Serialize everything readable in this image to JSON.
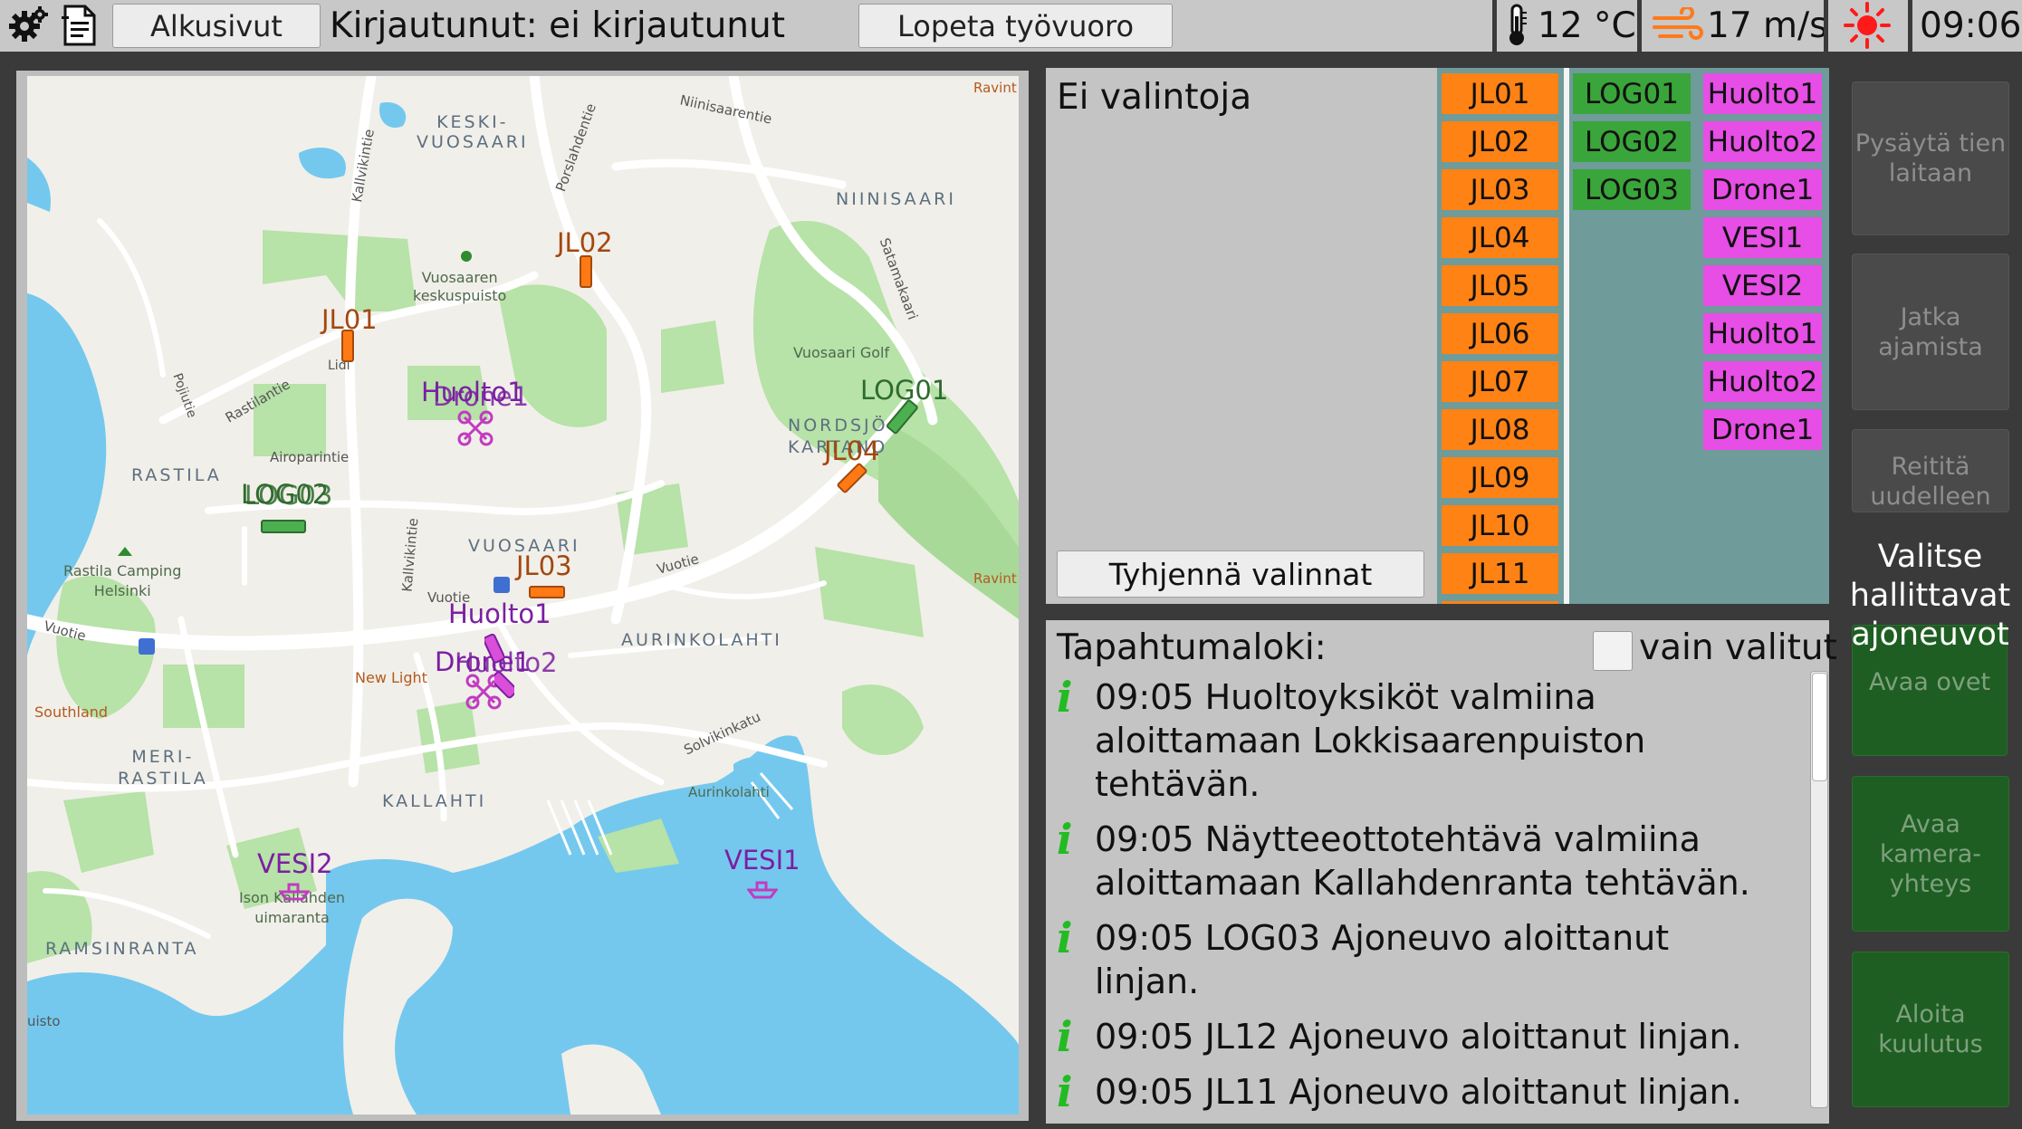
{
  "topbar": {
    "settings_icon": "gear-icon",
    "notes_icon": "document-icon",
    "home_button": "Alkusivut",
    "login_status": "Kirjautunut: ei kirjautunut",
    "end_shift_button": "Lopeta työvuoro",
    "temperature": "12 °C",
    "temperature_icon": "thermometer-icon",
    "wind": "17 m/s",
    "wind_icon": "wind-icon",
    "weather_icon": "sun-icon",
    "time": "09:06"
  },
  "map": {
    "place_labels": {
      "keskivuosaari_1": "KESKI-",
      "keskivuosaari_2": "VUOSAARI",
      "niinisaari": "NIINISAARI",
      "vuosaari_park_1": "Vuosaaren",
      "vuosaari_park_2": "keskuspuisto",
      "golf": "Vuosaari Golf",
      "nordsjo_1": "NORDSJÖ",
      "nordsjo_2": "KARTANO",
      "rastila": "RASTILA",
      "airoparintie": "Airoparintie",
      "camping_1": "Rastila Camping",
      "camping_2": "Helsinki",
      "vuosaari": "VUOSAARI",
      "aurinkolahti": "AURINKOLAHTI",
      "meri_1": "MERI-",
      "meri_2": "RASTILA",
      "kallahti": "KALLAHTI",
      "ramsinranta": "RAMSINRANTA",
      "southland": "Southland",
      "newlight": "New Light",
      "ison_1": "Ison Kallahden",
      "ison_2": "uimaranta",
      "aurinkolahti_beach": "Aurinkolahti",
      "ravint_top": "Ravint",
      "ravint_mid": "Ravint",
      "uisto": "uisto",
      "lidl": "Lidl"
    },
    "road_labels": {
      "kallvikintie_1": "Kallvikintie",
      "kallvikintie_2": "Kallvikintie",
      "porslahdentie": "Porslahdentie",
      "niinisaarentie": "Niinisaarentie",
      "satamakaari": "Satamakaari",
      "rastilantie": "Rastilantie",
      "pojiutie": "Pojiutie",
      "vuotie_1": "Vuotie",
      "vuotie_2": "Vuotie",
      "vuotie_3": "Vuotie",
      "solvikinkatu": "Solvikinkatu"
    },
    "vehicles": {
      "jl01": "JL01",
      "jl02": "JL02",
      "jl03": "JL03",
      "jl04": "JL04",
      "log01": "LOG01",
      "log02": "LOG02",
      "log03": "LOG03",
      "huolto1_a": "Huolto1",
      "drone1_a": "Drone1",
      "huolto1_b": "Huolto1",
      "huolto2_b": "Huolto2",
      "drone1_b": "Drone1",
      "vesi1": "VESI1",
      "vesi2": "VESI2"
    }
  },
  "selection": {
    "title": "Ei valintoja",
    "clear_button": "Tyhjennä valinnat",
    "jl_vehicles": [
      "JL01",
      "JL02",
      "JL03",
      "JL04",
      "JL05",
      "JL06",
      "JL07",
      "JL08",
      "JL09",
      "JL10",
      "JL11"
    ],
    "log_vehicles": [
      "LOG01",
      "LOG02",
      "LOG03"
    ],
    "service_vehicles": [
      "Huolto1",
      "Huolto2",
      "Drone1",
      "VESI1",
      "VESI2",
      "Huolto1",
      "Huolto2",
      "Drone1"
    ]
  },
  "event_log": {
    "title": "Tapahtumaloki:",
    "only_selected_label": "vain valitut",
    "info_icon": "info-icon",
    "entries": [
      "09:05 Huoltoyksiköt valmiina aloittamaan Lokkisaarenpuiston tehtävän.",
      "09:05 Näytteeottotehtävä valmiina aloittamaan Kallahdenranta tehtävän.",
      "09:05 LOG03 Ajoneuvo aloittanut linjan.",
      "09:05 JL12 Ajoneuvo aloittanut linjan.",
      "09:05 JL11 Ajoneuvo aloittanut linjan."
    ]
  },
  "actions": {
    "stop_roadside": "Pysäytä tien laitaan",
    "continue_driving": "Jatka ajamista",
    "reroute": "Reititä uudelleen",
    "open_doors": "Avaa ovet",
    "open_camera": "Avaa kamera-yhteys",
    "start_announcement": "Aloita kuulutus",
    "overlay_hint": "Valitse hallittavat ajoneuvot"
  },
  "colors": {
    "jl": "#ff8214",
    "log": "#3aa53a",
    "service": "#e64ee6",
    "water": "#74c8ee",
    "park": "#b7e2a8",
    "action_green": "#1e5e22"
  }
}
